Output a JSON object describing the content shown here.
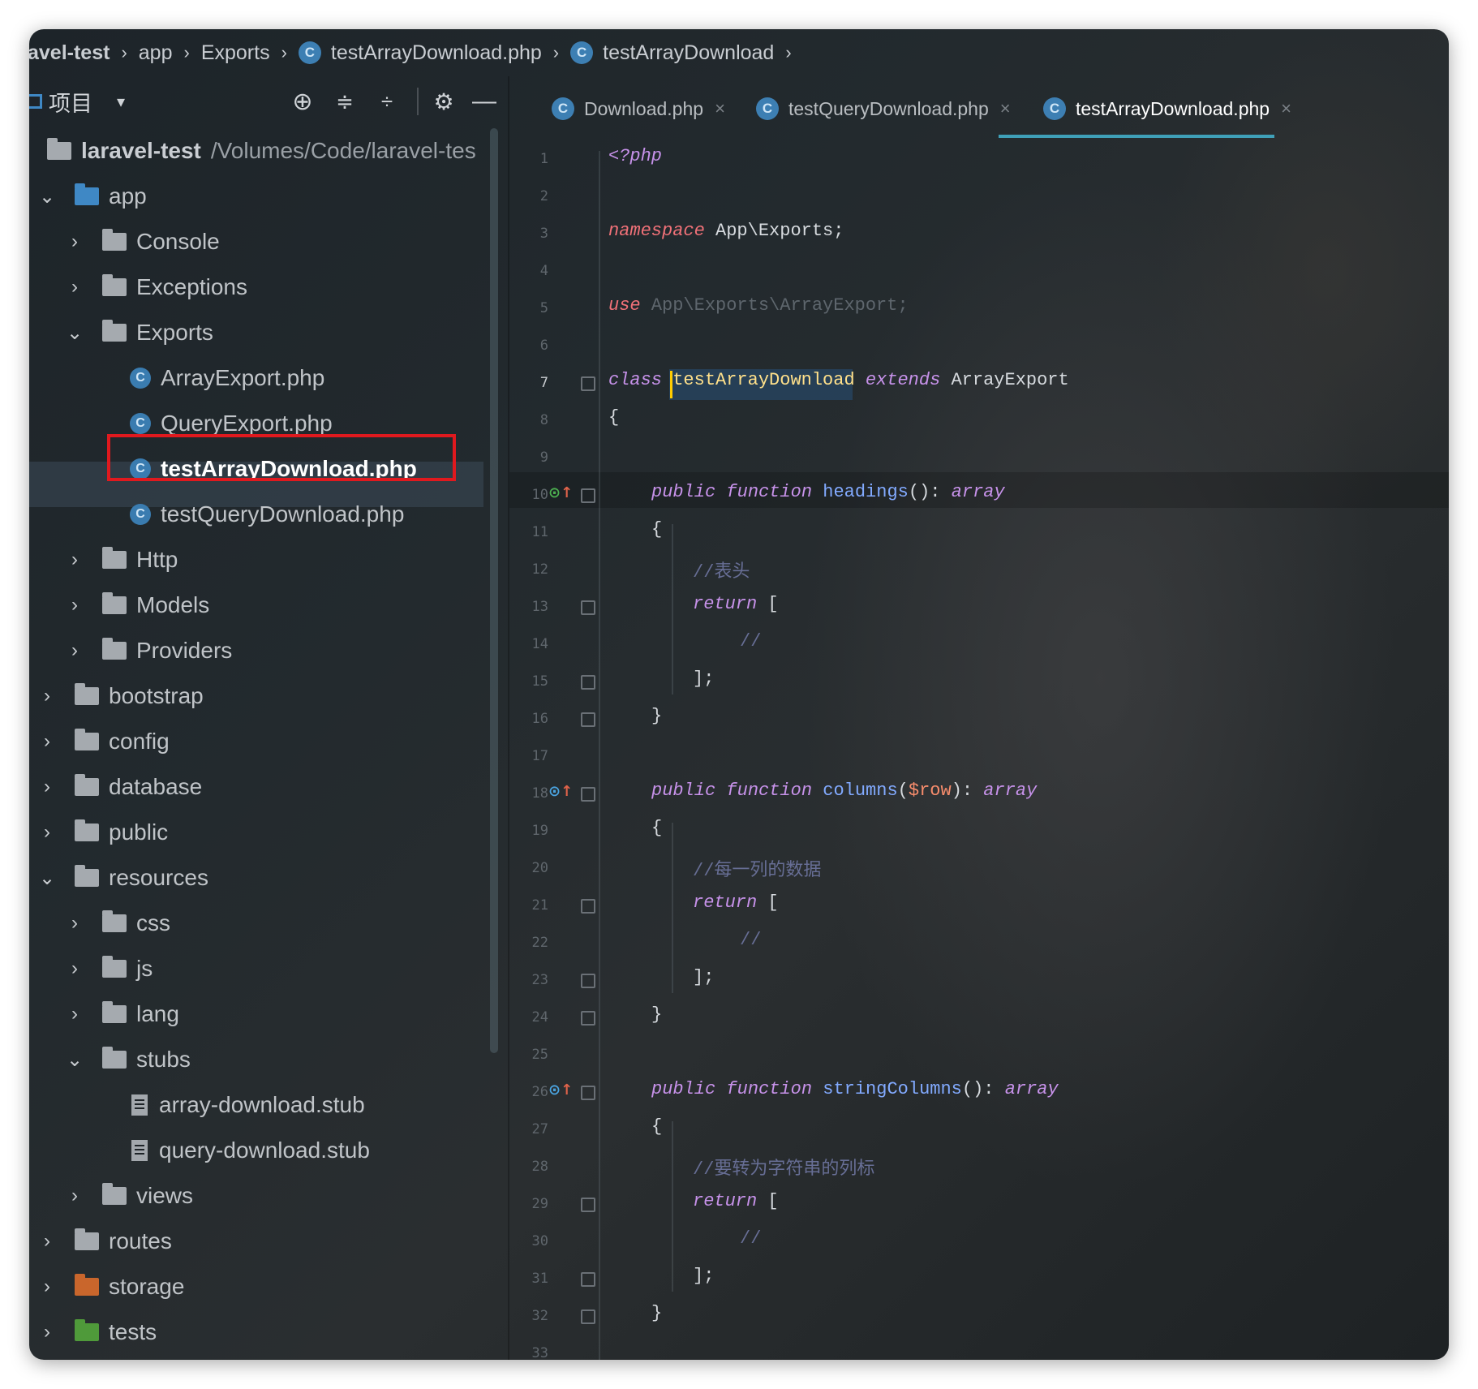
{
  "breadcrumb": {
    "items": [
      "avel-test",
      "app",
      "Exports",
      "testArrayDownload.php",
      "testArrayDownload"
    ]
  },
  "project_panel": {
    "title": "项目",
    "root_name": "laravel-test",
    "root_path": "/Volumes/Code/laravel-tes",
    "tree": [
      {
        "label": "app",
        "expanded": true
      },
      {
        "label": "Console"
      },
      {
        "label": "Exceptions"
      },
      {
        "label": "Exports",
        "expanded": true
      },
      {
        "label": "ArrayExport.php"
      },
      {
        "label": "QueryExport.php"
      },
      {
        "label": "testArrayDownload.php",
        "selected": true
      },
      {
        "label": "testQueryDownload.php"
      },
      {
        "label": "Http"
      },
      {
        "label": "Models"
      },
      {
        "label": "Providers"
      },
      {
        "label": "bootstrap"
      },
      {
        "label": "config"
      },
      {
        "label": "database"
      },
      {
        "label": "public"
      },
      {
        "label": "resources",
        "expanded": true
      },
      {
        "label": "css"
      },
      {
        "label": "js"
      },
      {
        "label": "lang"
      },
      {
        "label": "stubs",
        "expanded": true
      },
      {
        "label": "array-download.stub"
      },
      {
        "label": "query-download.stub"
      },
      {
        "label": "views"
      },
      {
        "label": "routes"
      },
      {
        "label": "storage"
      },
      {
        "label": "tests"
      }
    ]
  },
  "tabs": [
    {
      "label": "Download.php",
      "active": false
    },
    {
      "label": "testQueryDownload.php",
      "active": false
    },
    {
      "label": "testArrayDownload.php",
      "active": true
    }
  ],
  "editor": {
    "line_numbers": [
      "1",
      "2",
      "3",
      "4",
      "5",
      "6",
      "7",
      "8",
      "9",
      "10",
      "11",
      "12",
      "13",
      "14",
      "15",
      "16",
      "17",
      "18",
      "19",
      "20",
      "21",
      "22",
      "23",
      "24",
      "25",
      "26",
      "27",
      "28",
      "29",
      "30",
      "31",
      "32",
      "33"
    ],
    "lines": {
      "l1": "<?php",
      "l3_kw": "namespace",
      "l3_rest": " App\\Exports;",
      "l5_kw": "use",
      "l5_rest": " App\\Exports\\ArrayExport;",
      "l7_kw": "class",
      "l7_name": "testArrayDownload",
      "l7_ext": "extends",
      "l7_parent": "ArrayExport",
      "l8": "{",
      "l10_pub": "public",
      "l10_fn": "function",
      "l10_name": "headings",
      "l10_sig": "():",
      "l10_type": "array",
      "l11": "{",
      "l12": "//表头",
      "l13_kw": "return",
      "l13_rest": " [",
      "l14": "//",
      "l15": "];",
      "l16": "}",
      "l18_pub": "public",
      "l18_fn": "function",
      "l18_name": "columns",
      "l18_open": "(",
      "l18_var": "$row",
      "l18_close": "):",
      "l18_type": "array",
      "l19": "{",
      "l20": "//每一列的数据",
      "l21_kw": "return",
      "l21_rest": " [",
      "l22": "//",
      "l23": "];",
      "l24": "}",
      "l26_pub": "public",
      "l26_fn": "function",
      "l26_name": "stringColumns",
      "l26_sig": "():",
      "l26_type": "array",
      "l27": "{",
      "l28": "//要转为字符串的列标",
      "l29_kw": "return",
      "l29_rest": " [",
      "l30": "//",
      "l31": "];",
      "l32": "}"
    }
  },
  "colors": {
    "keyword": "#c792ea",
    "namespace_keyword": "#f07178",
    "function_name": "#82aaff",
    "variable": "#f78c6c",
    "comment": "#676e95",
    "selection_outline": "#e0191e",
    "tab_underline": "#3fa0b8"
  }
}
